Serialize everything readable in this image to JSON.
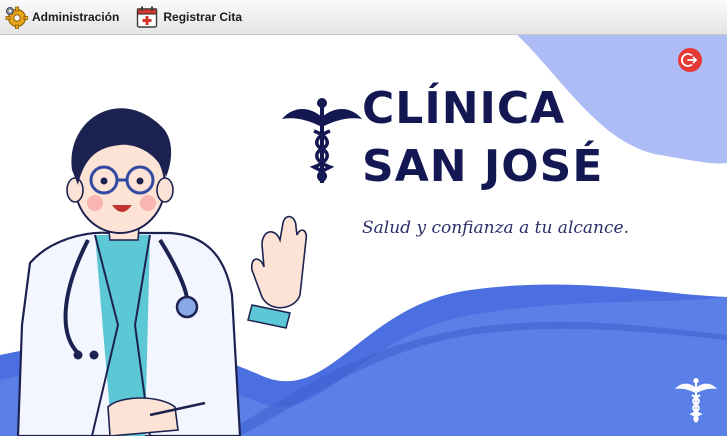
{
  "menu": {
    "items": [
      {
        "label": "Administración",
        "icon": "gear-icon"
      },
      {
        "label": "Registrar Cita",
        "icon": "calendar-add-icon"
      }
    ]
  },
  "hero": {
    "title_line1": "CLÍNICA",
    "title_line2": "SAN JOSÉ",
    "tagline": "Salud y confianza a tu alcance."
  },
  "colors": {
    "title": "#141852",
    "wave_light": "#aebcf5",
    "wave_blue": "#5a80e8",
    "logout_button": "#e53935"
  },
  "icons": {
    "logout": "logout-icon",
    "emblem": "caduceus-icon",
    "corner_emblem": "caduceus-icon"
  }
}
